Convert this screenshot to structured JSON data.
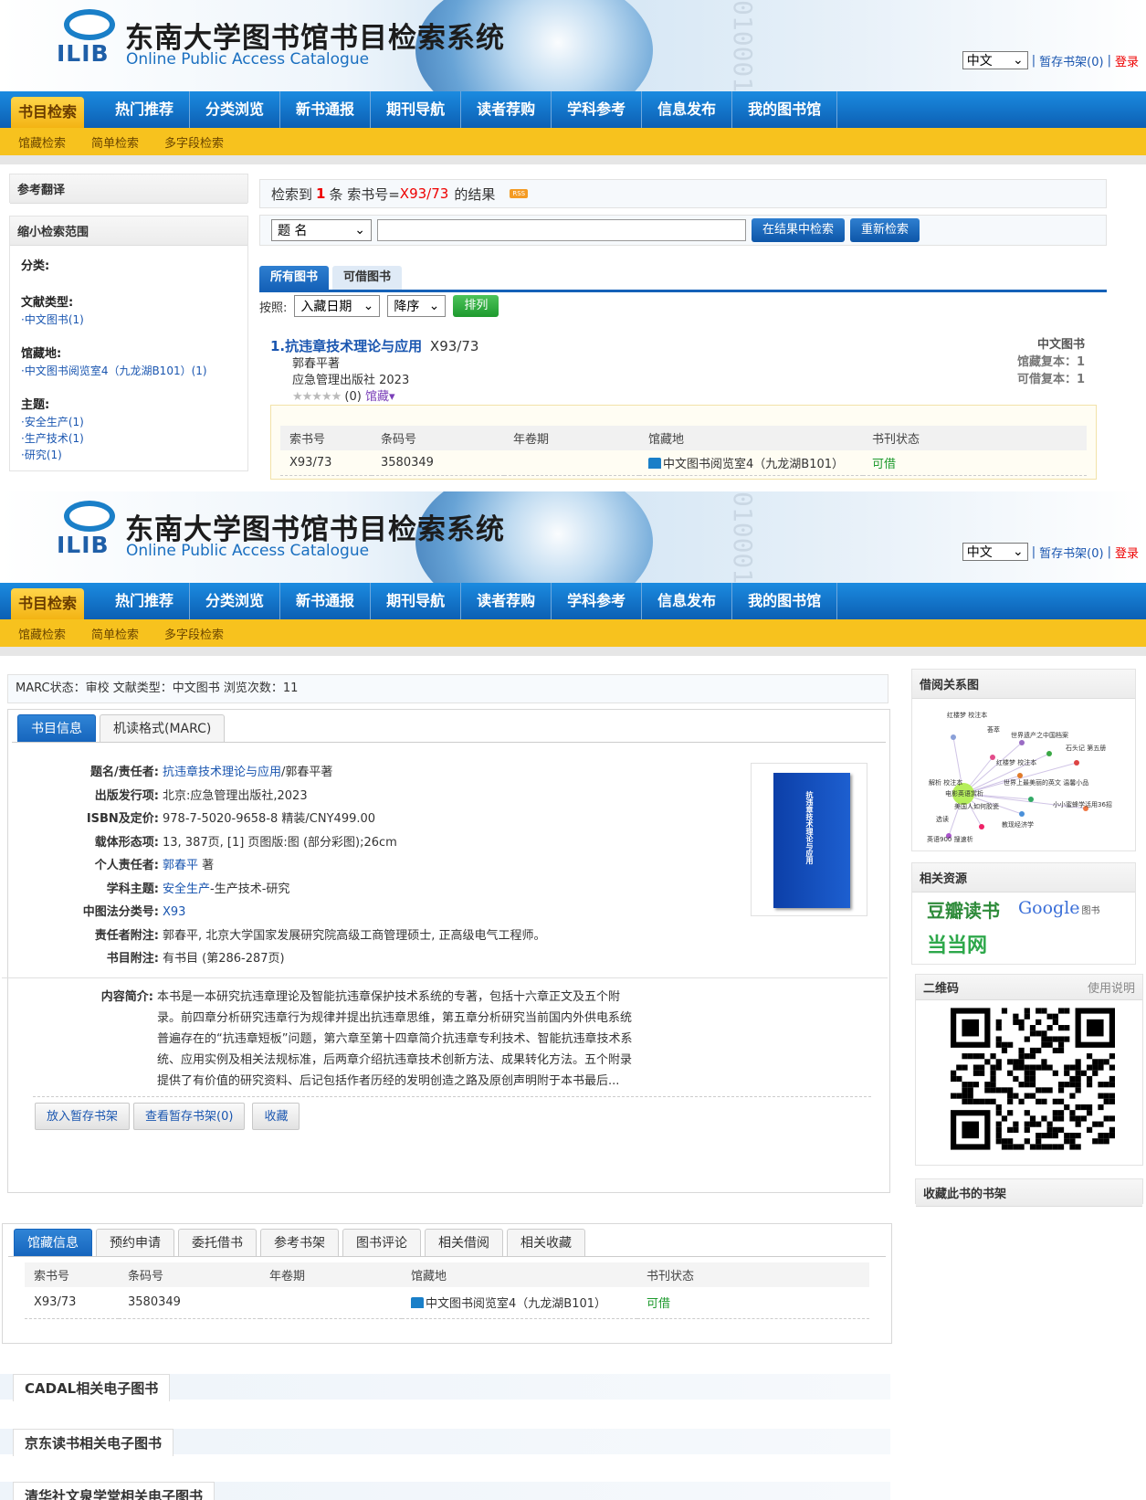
{
  "header": {
    "logo_text": "ILIB",
    "title": "东南大学图书馆书目检索系统",
    "subtitle": "Online Public Access Catalogue",
    "binary_deco": "01000100",
    "language": "中文",
    "shelf_link": "暂存书架(0)",
    "sep": "|",
    "login": "登录"
  },
  "nav": {
    "items": [
      "书目检索",
      "热门推荐",
      "分类浏览",
      "新书通报",
      "期刊导航",
      "读者荐购",
      "学科参考",
      "信息发布",
      "我的图书馆"
    ],
    "sub": [
      "馆藏检索",
      "简单检索",
      "多字段检索"
    ]
  },
  "sidebar": {
    "ref_title": "参考翻译",
    "narrow_title": "缩小检索范围",
    "cat_label": "分类:",
    "doctype_label": "文献类型:",
    "doctype_item": "·中文图书(1)",
    "location_label": "馆藏地:",
    "location_item": "·中文图书阅览室4（九龙湖B101）(1)",
    "subject_label": "主题:",
    "subjects": [
      "·安全生产(1)",
      "·生产技术(1)",
      "·研究(1)"
    ]
  },
  "results": {
    "prefix": "检索到",
    "count": "1",
    "middle": "条 索书号=",
    "query": "X93/73",
    "suffix": "的结果",
    "rss": "RSS",
    "field_select": "题 名",
    "btn_within": "在结果中检索",
    "btn_new": "重新检索",
    "tab_all": "所有图书",
    "tab_avail": "可借图书",
    "sort_label": "按照:",
    "sort_field": "入藏日期",
    "sort_order": "降序",
    "sort_btn": "排列",
    "item_title": "1.抗违章技术理论与应用",
    "item_callno": "X93/73",
    "item_author": "郭春平著",
    "item_pub": "应急管理出版社 2023",
    "item_rating": "(0)",
    "item_hold_link": "馆藏",
    "item_type": "中文图书",
    "item_copies": "馆藏复本：1",
    "item_loanable": "可借复本：1",
    "hold_headers": [
      "索书号",
      "条码号",
      "年卷期",
      "馆藏地",
      "书刊状态"
    ],
    "hold_row": [
      "X93/73",
      "3580349",
      "",
      "中文图书阅览室4（九龙湖B101）",
      "可借"
    ]
  },
  "detail": {
    "marc_status": "MARC状态：审校 文献类型：中文图书 浏览次数：11",
    "tab_info": "书目信息",
    "tab_marc": "机读格式(MARC)",
    "fields": {
      "title_k": "题名/责任者:",
      "title_link": "抗违章技术理论与应用",
      "title_rest": "/郭春平著",
      "pub_k": "出版发行项:",
      "pub_v": "北京:应急管理出版社,2023",
      "isbn_k": "ISBN及定价:",
      "isbn_v": "978-7-5020-9658-8 精装/CNY499.00",
      "form_k": "载体形态项:",
      "form_v": "13, 387页, [1] 页图版:图 (部分彩图);26cm",
      "person_k": "个人责任者:",
      "person_link": "郭春平",
      "person_rest": " 著",
      "subject_k": "学科主题:",
      "subject_link": "安全生产",
      "subject_rest": "-生产技术-研究",
      "clc_k": "中图法分类号:",
      "clc_v": "X93",
      "note_k": "责任者附注:",
      "note_v": "郭春平, 北京大学国家发展研究院高级工商管理硕士, 正高级电气工程师。",
      "bib_k": "书目附注:",
      "bib_v": "有书目 (第286-287页)",
      "abstract_k": "内容简介:",
      "abstract_lines": [
        "本书是一本研究抗违章理论及智能抗违章保护技术系统的专著，包括十六章正文及五个附",
        "录。前四章分析研究违章行为规律并提出抗违章思维，第五章分析研究当前国内外供电系统",
        "普遍存在的“抗违章短板”问题，第六章至第十四章简介抗违章专利技术、智能抗违章技术系",
        "统、应用实例及相关法规标准，后两章介绍抗违章技术创新方法、成果转化方法。五个附录",
        "提供了有价值的研究资料、后记包括作者历经的发明创造之路及原创声明附于本书最后..."
      ]
    },
    "cover_title": "抗违章技术理论与应用",
    "btn_add": "放入暂存书架",
    "btn_view": "查看暂存书架(0)",
    "btn_fav": "收藏"
  },
  "holdings2": {
    "tabs": [
      "馆藏信息",
      "预约申请",
      "委托借书",
      "参考书架",
      "图书评论",
      "相关借阅",
      "相关收藏"
    ],
    "headers": [
      "索书号",
      "条码号",
      "年卷期",
      "馆藏地",
      "书刊状态"
    ],
    "row": [
      "X93/73",
      "3580349",
      "",
      "中文图书阅览室4（九龙湖B101）",
      "可借"
    ]
  },
  "sections": [
    "CADAL相关电子图书",
    "京东读书相关电子图书",
    "清华社文泉学堂相关电子图书"
  ],
  "right": {
    "graph_title": "借阅关系图",
    "graph_labels": [
      "红楼梦 校注本",
      "荟萃",
      "世界遗产之中国档案",
      "石头记 第五册",
      "红楼梦 校注本",
      "解析 校注本",
      "世界上最美丽的英文 温馨小品",
      "电影英语赏析",
      "美国人如何胶瓷",
      "小小蜜蜂学活用36招",
      "选读",
      "教现经济学",
      "英语900 搜速析"
    ],
    "res_title": "相关资源",
    "res_douban": "豆瓣读书",
    "res_google": "Google",
    "res_google_sub": "图书",
    "res_dangdang": "当当网",
    "qr_title": "二维码",
    "qr_help": "使用说明",
    "shelf_title": "收藏此书的书架"
  },
  "colors": {
    "nav_blue": "#0c5fb3",
    "nav_yellow": "#f7c21e",
    "link": "#1a56b0",
    "avail": "#1e9a2e",
    "red": "#e00000"
  }
}
